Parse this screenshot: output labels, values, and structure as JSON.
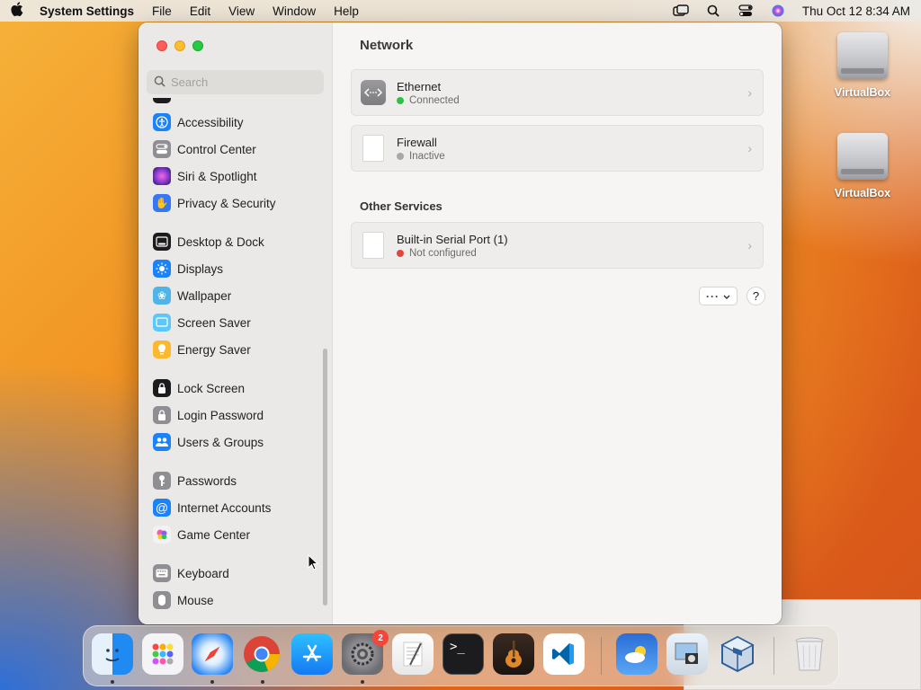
{
  "menubar": {
    "apple_icon": "apple-logo",
    "app_name": "System Settings",
    "menus": [
      "File",
      "Edit",
      "View",
      "Window",
      "Help"
    ],
    "clock": "Thu Oct 12  8:34 AM",
    "status_icons": [
      "screen-mirroring-icon",
      "spotlight-search-icon",
      "control-center-icon",
      "siri-icon"
    ]
  },
  "desktop": {
    "icons": [
      {
        "label": "VirtualBox",
        "icon": "disk-drive-icon"
      },
      {
        "label": "VirtualBox",
        "icon": "disk-drive-icon"
      }
    ]
  },
  "sidebar": {
    "search_placeholder": "Search",
    "items": [
      {
        "label": "Accessibility",
        "icon": "accessibility-icon",
        "color": "#1a82fb"
      },
      {
        "label": "Control Center",
        "icon": "control-center-icon",
        "color": "#8e8e93"
      },
      {
        "label": "Siri & Spotlight",
        "icon": "siri-icon",
        "color": "#8a3ad6"
      },
      {
        "label": "Privacy & Security",
        "icon": "hand-icon",
        "color": "#3478f6"
      },
      {
        "label": "Desktop & Dock",
        "icon": "dock-icon",
        "color": "#1c1c1e"
      },
      {
        "label": "Displays",
        "icon": "sun-icon",
        "color": "#1a82fb"
      },
      {
        "label": "Wallpaper",
        "icon": "wallpaper-icon",
        "color": "#4fb4e8"
      },
      {
        "label": "Screen Saver",
        "icon": "screen-saver-icon",
        "color": "#5ac8fa"
      },
      {
        "label": "Energy Saver",
        "icon": "lightbulb-icon",
        "color": "#fdb92e"
      },
      {
        "label": "Lock Screen",
        "icon": "lock-icon",
        "color": "#1c1c1e"
      },
      {
        "label": "Login Password",
        "icon": "lock-icon",
        "color": "#8e8e93"
      },
      {
        "label": "Users & Groups",
        "icon": "users-icon",
        "color": "#1a82fb"
      },
      {
        "label": "Passwords",
        "icon": "key-icon",
        "color": "#8e8e93"
      },
      {
        "label": "Internet Accounts",
        "icon": "at-icon",
        "color": "#1a82fb"
      },
      {
        "label": "Game Center",
        "icon": "game-center-icon",
        "color": "#e8e8e8"
      },
      {
        "label": "Keyboard",
        "icon": "keyboard-icon",
        "color": "#8e8e93"
      },
      {
        "label": "Mouse",
        "icon": "mouse-icon",
        "color": "#8e8e93"
      }
    ]
  },
  "main": {
    "title": "Network",
    "services": [
      {
        "name": "Ethernet",
        "status": "Connected",
        "status_color": "#30c048",
        "icon": "ethernet-icon"
      },
      {
        "name": "Firewall",
        "status": "Inactive",
        "status_color": "#a9a7a4",
        "icon": "document-icon"
      }
    ],
    "other_services_title": "Other Services",
    "other_services": [
      {
        "name": "Built-in Serial Port (1)",
        "status": "Not configured",
        "status_color": "#e5443a",
        "icon": "document-icon"
      }
    ],
    "more_button_label": "···",
    "help_button_label": "?"
  },
  "dock": {
    "apps": [
      {
        "name": "Finder",
        "icon": "finder-icon",
        "running": true
      },
      {
        "name": "Launchpad",
        "icon": "launchpad-icon",
        "running": false
      },
      {
        "name": "Safari",
        "icon": "safari-icon",
        "running": true
      },
      {
        "name": "Google Chrome",
        "icon": "chrome-icon",
        "running": true
      },
      {
        "name": "App Store",
        "icon": "app-store-icon",
        "running": false
      },
      {
        "name": "System Settings",
        "icon": "system-settings-icon",
        "running": true,
        "badge": "2"
      },
      {
        "name": "TextEdit",
        "icon": "textedit-icon",
        "running": false
      },
      {
        "name": "Terminal",
        "icon": "terminal-icon",
        "running": false
      },
      {
        "name": "GarageBand",
        "icon": "garageband-icon",
        "running": false
      },
      {
        "name": "Visual Studio Code",
        "icon": "vscode-icon",
        "running": false
      },
      {
        "name": "Weather",
        "icon": "weather-icon",
        "running": false
      },
      {
        "name": "Preview",
        "icon": "preview-icon",
        "running": false
      },
      {
        "name": "VirtualBox",
        "icon": "virtualbox-icon",
        "running": false
      },
      {
        "name": "Trash",
        "icon": "trash-icon",
        "running": false
      }
    ]
  }
}
